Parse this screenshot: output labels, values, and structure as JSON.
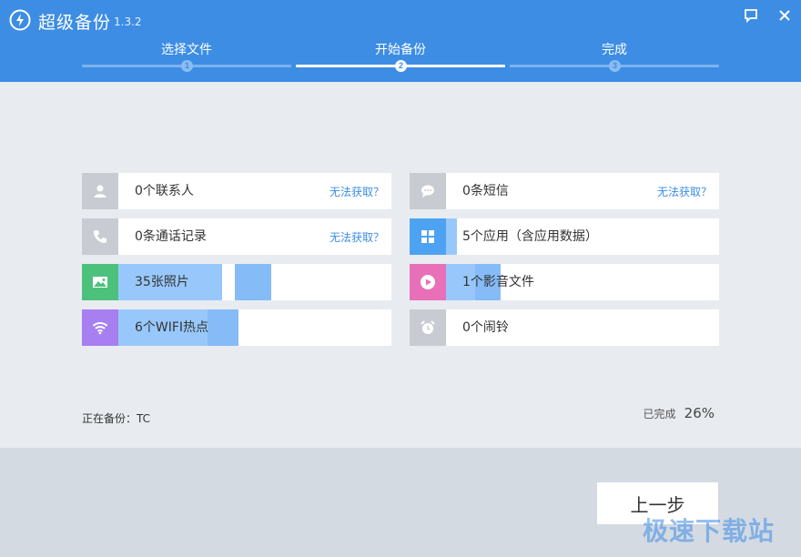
{
  "app": {
    "title": "超级备份",
    "version": "1.3.2",
    "feedback_icon": "feedback-icon",
    "close_icon": "close-icon"
  },
  "steps": [
    {
      "label": "选择文件",
      "number": "1",
      "active": false
    },
    {
      "label": "开始备份",
      "number": "2",
      "active": true
    },
    {
      "label": "完成",
      "number": "3",
      "active": false
    }
  ],
  "items": [
    {
      "label": "0个联系人",
      "link": "无法获取？",
      "icon": "contact-icon",
      "icon_color": "#c8ccd2",
      "progress": 0
    },
    {
      "label": "0条短信",
      "link": "无法获取？",
      "icon": "message-icon",
      "icon_color": "#c8ccd2",
      "progress": 0
    },
    {
      "label": "0条通话记录",
      "link": "无法获取？",
      "icon": "phone-icon",
      "icon_color": "#c8ccd2",
      "progress": 0
    },
    {
      "label": "5个应用（含应用数据）",
      "link": "",
      "icon": "apps-icon",
      "icon_color": "#4da3f1",
      "progress": 0.04
    },
    {
      "label": "35张照片",
      "link": "",
      "icon": "photo-icon",
      "icon_color": "#4cc17b",
      "progress": 0.38
    },
    {
      "label": "1个影音文件",
      "link": "",
      "icon": "media-play-icon",
      "icon_color": "#e870b8",
      "progress": 0.2
    },
    {
      "label": "6个WIFI热点",
      "link": "",
      "icon": "wifi-icon",
      "icon_color": "#a77ff0",
      "progress": 0.44
    },
    {
      "label": "0个闹铃",
      "link": "",
      "icon": "alarm-clock-icon",
      "icon_color": "#c8ccd2",
      "progress": 0
    }
  ],
  "status": {
    "backing_up": "正在备份：TC",
    "completed_label": "已完成",
    "completed_value": "26%"
  },
  "footer": {
    "prev_label": "上一步",
    "watermark": "极速下载站"
  }
}
